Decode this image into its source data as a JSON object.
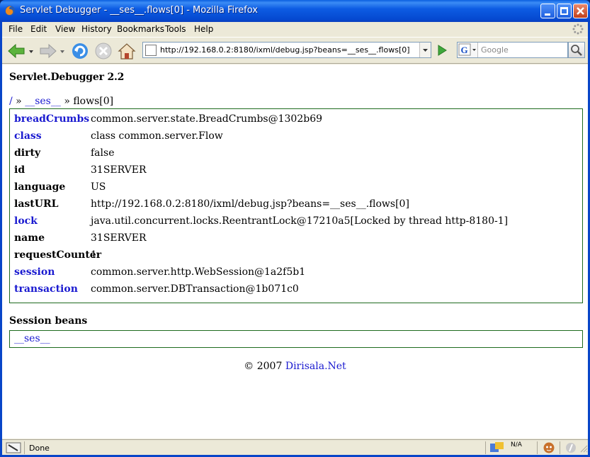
{
  "window": {
    "title": "Servlet Debugger - __ses__.flows[0] - Mozilla Firefox"
  },
  "menu": {
    "items": [
      {
        "label": "File"
      },
      {
        "label": "Edit"
      },
      {
        "label": "View"
      },
      {
        "label": "History"
      },
      {
        "label": "Bookmarks"
      },
      {
        "label": "Tools"
      },
      {
        "label": "Help"
      }
    ]
  },
  "nav": {
    "url": "http://192.168.0.2:8180/ixml/debug.jsp?beans=__ses__.flows[0]",
    "search_placeholder": "Google"
  },
  "page": {
    "app_name": "Servlet.Debugger",
    "version": "2.2",
    "breadcrumb": {
      "root": "/",
      "sep1": "»",
      "ses": "__ses__",
      "sep2": "»",
      "current": "flows[0]"
    },
    "properties": [
      {
        "key": "breadCrumbs",
        "value": "common.server.state.BreadCrumbs@1302b69",
        "link": true
      },
      {
        "key": "class",
        "value": "class common.server.Flow",
        "link": true
      },
      {
        "key": "dirty",
        "value": "false",
        "link": false
      },
      {
        "key": "id",
        "value": "31SERVER",
        "link": false
      },
      {
        "key": "language",
        "value": "US",
        "link": false
      },
      {
        "key": "lastURL",
        "value": "http://192.168.0.2:8180/ixml/debug.jsp?beans=__ses__.flows[0]",
        "link": false
      },
      {
        "key": "lock",
        "value": "java.util.concurrent.locks.ReentrantLock@17210a5[Locked by thread http-8180-1]",
        "link": true
      },
      {
        "key": "name",
        "value": "31SERVER",
        "link": false
      },
      {
        "key": "requestCounter",
        "value": "1",
        "link": false
      },
      {
        "key": "session",
        "value": "common.server.http.WebSession@1a2f5b1",
        "link": true
      },
      {
        "key": "transaction",
        "value": "common.server.DBTransaction@1b071c0",
        "link": true
      }
    ],
    "session_beans_title": "Session beans",
    "session_beans": [
      "__ses__"
    ],
    "footer": {
      "copyright": "© 2007",
      "link": "Dirisala.Net"
    }
  },
  "status": {
    "text": "Done",
    "na": "N/A"
  },
  "colors": {
    "link": "#1a1ad0",
    "box_border": "#1e6b1e",
    "titlebar": "#0549d0"
  }
}
